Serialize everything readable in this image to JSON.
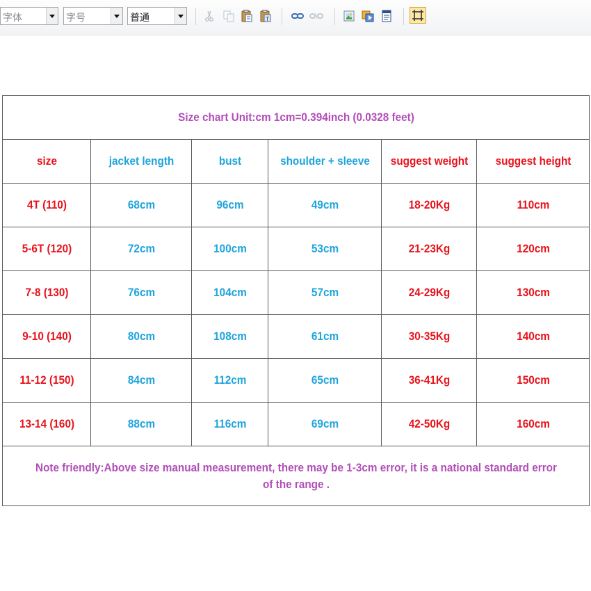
{
  "toolbar": {
    "font_family_placeholder": "字体",
    "font_size_placeholder": "字号",
    "paragraph_format_value": "普通",
    "icons": [
      "cut-icon",
      "copy-icon",
      "paste-icon",
      "paste-text-icon",
      "link-icon",
      "unlink-icon",
      "insert-image-icon",
      "insert-flash-icon",
      "insert-file-icon",
      "fullscreen-icon"
    ]
  },
  "table": {
    "title": "Size chart Unit:cm  1cm=0.394inch (0.0328 feet)",
    "headers": [
      "size",
      "jacket length",
      "bust",
      "shoulder + sleeve",
      "suggest weight",
      "suggest height"
    ],
    "rows": [
      [
        "4T (110)",
        "68cm",
        "96cm",
        "49cm",
        "18-20Kg",
        "110cm"
      ],
      [
        "5-6T (120)",
        "72cm",
        "100cm",
        "53cm",
        "21-23Kg",
        "120cm"
      ],
      [
        "7-8 (130)",
        "76cm",
        "104cm",
        "57cm",
        "24-29Kg",
        "130cm"
      ],
      [
        "9-10 (140)",
        "80cm",
        "108cm",
        "61cm",
        "30-35Kg",
        "140cm"
      ],
      [
        "11-12 (150)",
        "84cm",
        "112cm",
        "65cm",
        "36-41Kg",
        "150cm"
      ],
      [
        "13-14 (160)",
        "88cm",
        "116cm",
        "69cm",
        "42-50Kg",
        "160cm"
      ]
    ],
    "note": "Note friendly:Above size manual measurement, there may be 1-3cm error, it is a national standard error of the range .",
    "colors": {
      "red": "#e8121b",
      "blue": "#1ea4dc",
      "purple": "#b24db9"
    }
  }
}
